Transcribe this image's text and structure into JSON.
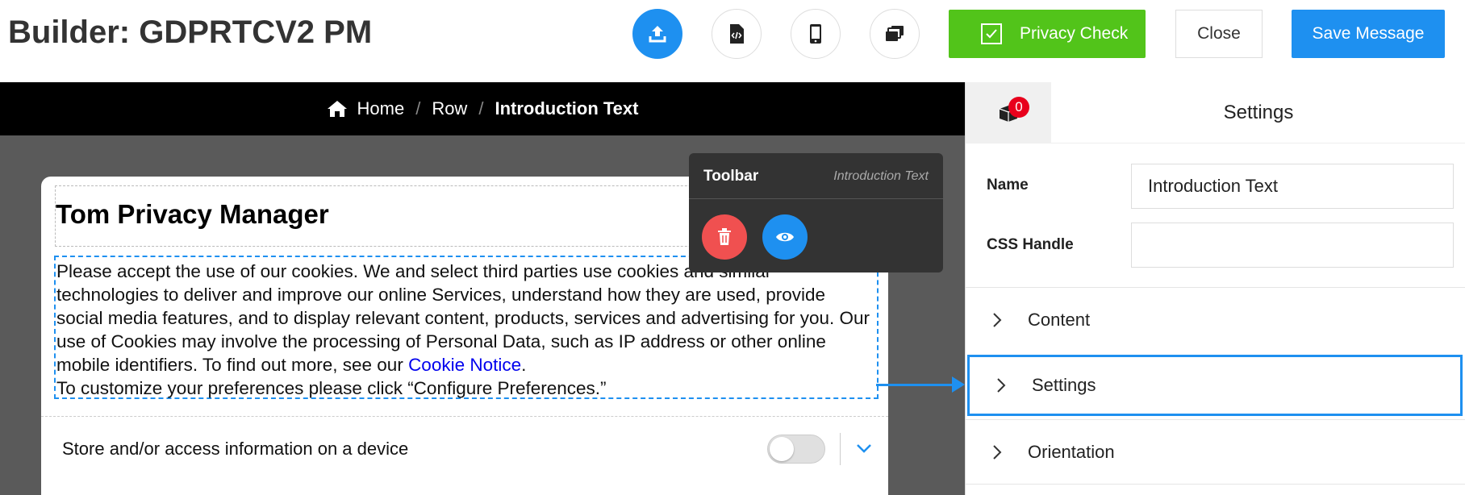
{
  "header": {
    "title": "Builder: GDPRTCV2 PM",
    "privacy_check_label": "Privacy Check",
    "close_label": "Close",
    "save_label": "Save Message",
    "icons": [
      "upload-icon",
      "code-file-icon",
      "mobile-icon",
      "layers-icon"
    ]
  },
  "breadcrumb": {
    "home": "Home",
    "row": "Row",
    "current": "Introduction Text",
    "separator": "/"
  },
  "message": {
    "title": "Tom Privacy Manager",
    "body_text": "Please accept the use of our cookies. We and select third parties use cookies and similar technologies to deliver and improve our online Services, understand how they are used, provide social media features, and to display relevant content, products, services and advertising for you. Our use of Cookies may involve the processing of Personal Data, such as IP address or other online mobile identifiers. To find out more, see our ",
    "link_text": "Cookie Notice",
    "period": ".",
    "body_text_2": "To customize your preferences please click “Configure Preferences.”",
    "purpose_label": "Store and/or access information on a device",
    "purpose_toggle_on": false
  },
  "toolbar": {
    "title": "Toolbar",
    "context": "Introduction Text"
  },
  "panel": {
    "badge_count": "0",
    "title": "Settings",
    "name_label": "Name",
    "name_value": "Introduction Text",
    "css_label": "CSS Handle",
    "css_value": "",
    "sections": [
      "Content",
      "Settings",
      "Orientation"
    ],
    "selected_section": "Settings"
  },
  "colors": {
    "accent": "#1e90f0",
    "privacy_green": "#52c41a",
    "delete_red": "#f05050",
    "badge_red": "#e8001c"
  }
}
